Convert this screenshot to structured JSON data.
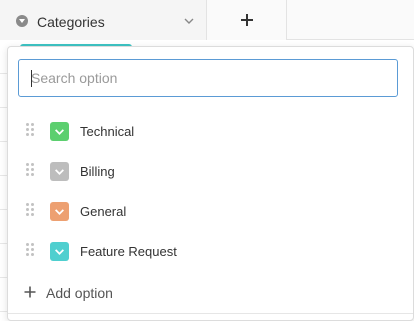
{
  "header": {
    "column_title": "Categories",
    "column_icon": "single-select-icon",
    "menu_icon": "chevron-down-icon",
    "add_column_icon": "plus-icon"
  },
  "dropdown": {
    "search_placeholder": "Search option",
    "search_value": "",
    "options": [
      {
        "label": "Technical",
        "color": "#5ccf6f"
      },
      {
        "label": "Billing",
        "color": "#bdbdbd"
      },
      {
        "label": "General",
        "color": "#eda071"
      },
      {
        "label": "Feature Request",
        "color": "#4fcfcf"
      }
    ],
    "add_option_label": "Add option",
    "accent_color": "#5b9bd5"
  }
}
